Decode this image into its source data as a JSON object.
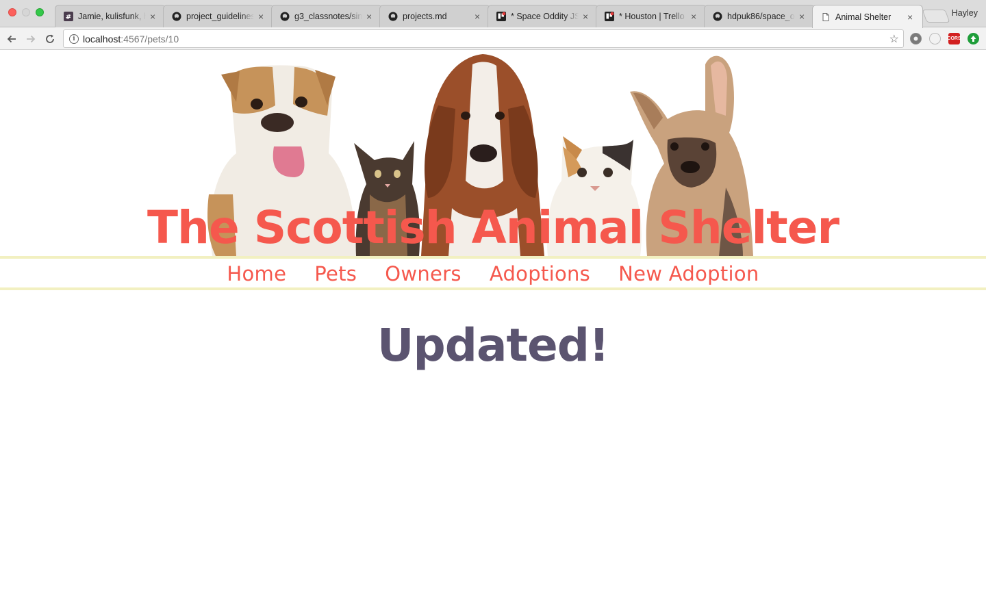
{
  "browser": {
    "profile_name": "Hayley",
    "tabs": [
      {
        "title": "Jamie, kulisfunk, h",
        "icon": "slack-hash-icon"
      },
      {
        "title": "project_guidelines",
        "icon": "github-icon"
      },
      {
        "title": "g3_classnotes/sin",
        "icon": "github-icon"
      },
      {
        "title": "projects.md",
        "icon": "github-icon"
      },
      {
        "title": "* Space Oddity JS",
        "icon": "trello-icon"
      },
      {
        "title": "* Houston | Trello",
        "icon": "trello-icon"
      },
      {
        "title": "hdpuk86/space_o",
        "icon": "github-icon"
      },
      {
        "title": "Animal Shelter",
        "icon": "page-icon",
        "active": true
      }
    ],
    "url_host": "localhost",
    "url_path": ":4567/pets/10",
    "extensions": [
      "settings-extension-icon",
      "circle-extension-icon",
      "cors-extension-icon",
      "upload-extension-icon"
    ],
    "cors_label": "CORS"
  },
  "page": {
    "site_title": "The Scottish Animal Shelter",
    "nav": [
      {
        "label": "Home"
      },
      {
        "label": "Pets"
      },
      {
        "label": "Owners"
      },
      {
        "label": "Adoptions"
      },
      {
        "label": "New Adoption"
      }
    ],
    "message": "Updated!",
    "colors": {
      "accent": "#f5584d",
      "heading": "#5b5470",
      "nav_border": "#f2f0c1"
    }
  }
}
